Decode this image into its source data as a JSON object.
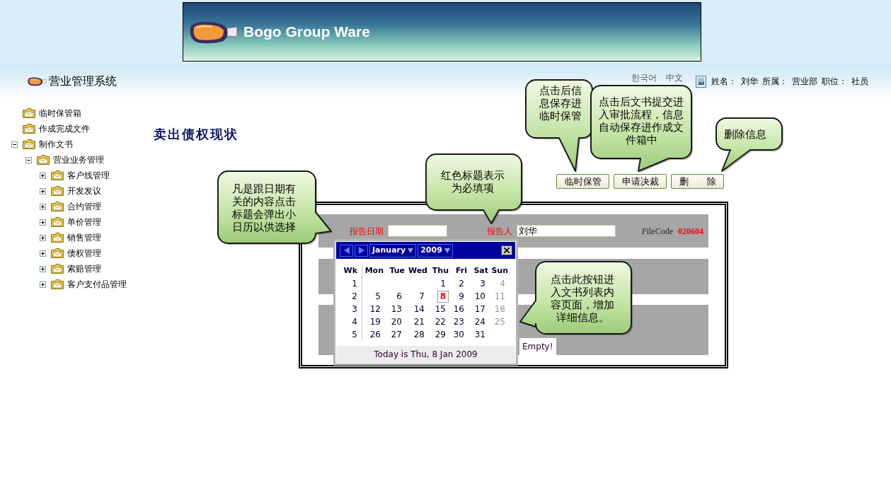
{
  "banner": {
    "title": "Bogo Group Ware"
  },
  "header": {
    "system_name": "营业管理系统",
    "languages": [
      "한국어",
      "中文"
    ],
    "user_info": [
      {
        "label": "姓名：",
        "value": "刘华"
      },
      {
        "label": "所属：",
        "value": "营业部"
      },
      {
        "label": "职位：",
        "value": "社员"
      }
    ]
  },
  "sidebar": {
    "items": [
      {
        "label": "临时保管箱"
      },
      {
        "label": "作成完成文件"
      },
      {
        "label": "制作文书",
        "expanded": true,
        "children": [
          {
            "label": "营业业务管理",
            "expanded": true,
            "children": [
              {
                "label": "客户线管理",
                "expanded": false
              },
              {
                "label": "开发发议",
                "expanded": false
              },
              {
                "label": "合约管理",
                "expanded": false
              },
              {
                "label": "单价管理",
                "expanded": false
              },
              {
                "label": "销售管理",
                "expanded": false
              },
              {
                "label": "债权管理",
                "expanded": false
              },
              {
                "label": "索赔管理",
                "expanded": false
              },
              {
                "label": "客户支付品管理",
                "expanded": false
              }
            ]
          }
        ]
      }
    ]
  },
  "page_title": "卖出债权现状",
  "buttons": [
    "临时保管",
    "申请决裁",
    "删　　除"
  ],
  "form": {
    "fields": [
      {
        "label": "报告日期",
        "required": true
      },
      {
        "label": "报告人",
        "required": true,
        "value": "刘华"
      }
    ],
    "file_code": {
      "label": "FileCode",
      "value": "020604"
    },
    "list_status": "Empty!"
  },
  "calendar": {
    "month": "January",
    "year": "2009",
    "week_header": "Wk",
    "weekdays": [
      "Mon",
      "Tue",
      "Wed",
      "Thu",
      "Fri",
      "Sat",
      "Sun"
    ],
    "weeks": [
      {
        "number": "1",
        "days": [
          {
            "day": "1",
            "today": false
          },
          {
            "day": "2",
            "today": false
          },
          {
            "day": "3",
            "today": false
          },
          {
            "day": "4",
            "today": false
          }
        ]
      },
      {
        "number": "2",
        "days": [
          {
            "day": "5",
            "today": false
          },
          {
            "day": "6",
            "today": false
          },
          {
            "day": "7",
            "today": false
          },
          {
            "day": "8",
            "today": true
          },
          {
            "day": "9",
            "today": false
          },
          {
            "day": "10",
            "today": false
          },
          {
            "day": "11",
            "today": false
          }
        ]
      },
      {
        "number": "3",
        "days": [
          {
            "day": "12",
            "today": false
          },
          {
            "day": "13",
            "today": false
          },
          {
            "day": "14",
            "today": false
          },
          {
            "day": "15",
            "today": false
          },
          {
            "day": "16",
            "today": false
          },
          {
            "day": "17",
            "today": false
          },
          {
            "day": "18",
            "today": false
          }
        ]
      },
      {
        "number": "4",
        "days": [
          {
            "day": "19",
            "today": false
          },
          {
            "day": "20",
            "today": false
          },
          {
            "day": "21",
            "today": false
          },
          {
            "day": "22",
            "today": false
          },
          {
            "day": "23",
            "today": false
          },
          {
            "day": "24",
            "today": false
          },
          {
            "day": "25",
            "today": false
          }
        ]
      },
      {
        "number": "5",
        "days": [
          {
            "day": "26",
            "today": false
          },
          {
            "day": "27",
            "today": false
          },
          {
            "day": "28",
            "today": false
          },
          {
            "day": "29",
            "today": false
          },
          {
            "day": "30",
            "today": false
          },
          {
            "day": "31",
            "today": false
          }
        ]
      }
    ],
    "footer": "Today is Thu, 8 Jan 2009"
  },
  "callouts": [
    "点击后信息保存进临时保管",
    "点击后文书提交进入审批流程，信息自动保存进作成文件箱中",
    "删除信息",
    "红色标题表示为必填项",
    "凡是跟日期有关的内容点击标题会弹出小日历以供选择",
    "点击此按钮进入文书列表内容页面，增加详细信息。"
  ]
}
